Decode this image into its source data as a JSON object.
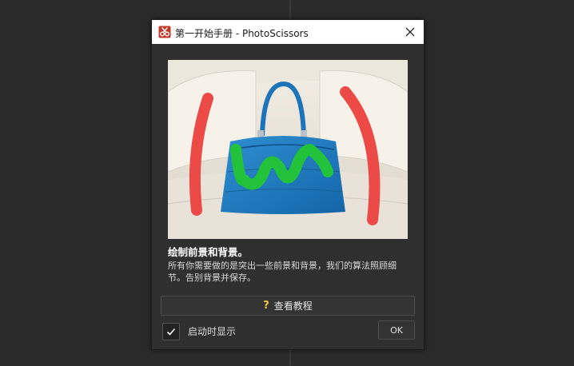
{
  "window": {
    "title": "第一开始手册 - PhotoScissors"
  },
  "content": {
    "heading": "绘制前景和背景。",
    "description": "所有你需要做的是突出一些前景和背景，我们的算法照顾细节。告别背景并保存。"
  },
  "buttons": {
    "tutorial_label": "查看教程",
    "ok_label": "OK"
  },
  "options": {
    "show_at_startup_label": "启动时显示",
    "show_at_startup_checked": true
  },
  "icons": {
    "app": "photoscissors-app-icon",
    "close": "close-icon",
    "help": "question-icon",
    "check": "checkmark-icon"
  },
  "colors": {
    "background": "#2b2b2b",
    "dialog": "#2f2f2f",
    "foreground_stroke": "#22c33a",
    "background_stroke": "#ec4a46",
    "help_icon": "#f2c744"
  }
}
